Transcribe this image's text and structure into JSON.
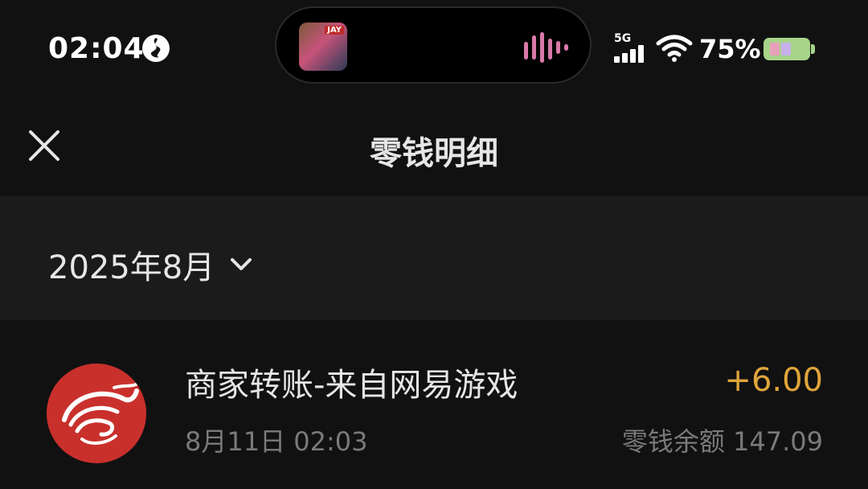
{
  "status_bar": {
    "time": "02:04",
    "network": "5G",
    "battery_percent": "75%",
    "signal_level": 4,
    "battery_level": 0.75,
    "now_playing_badge": "JAY"
  },
  "header": {
    "title": "零钱明细",
    "close_icon": "close-icon"
  },
  "filter": {
    "month": "2025年8月",
    "dropdown_icon": "chevron-down-icon"
  },
  "transactions": [
    {
      "title": "商家转账-来自网易游戏",
      "date": "8月11日 02:03",
      "amount": "+6.00",
      "balance": "零钱余额 147.09",
      "logo": "netease-logo",
      "amount_color": "#e0a53a"
    }
  ],
  "colors": {
    "background": "#111111",
    "filter_bar": "#1b1b1b",
    "income": "#e0a53a",
    "logo_red": "#c9302c"
  }
}
